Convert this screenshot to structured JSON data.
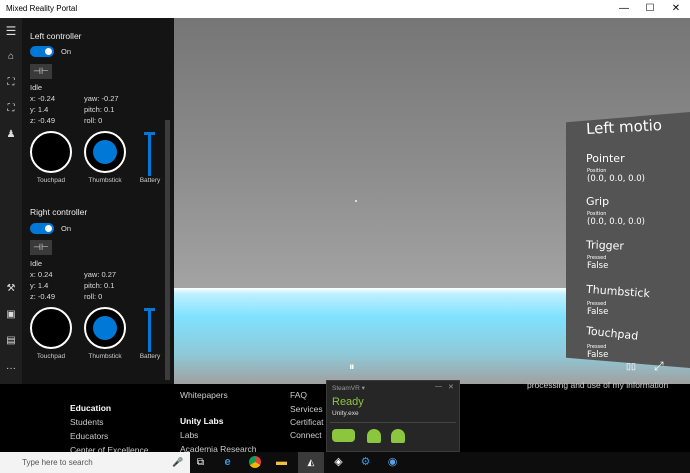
{
  "window": {
    "title": "Mixed Reality Portal",
    "minimize": "—",
    "maximize": "☐",
    "close": "✕"
  },
  "sidebar": {
    "items": [
      {
        "icon": "menu-icon",
        "glyph": "☰"
      },
      {
        "icon": "headset-icon",
        "glyph": "⌂"
      },
      {
        "icon": "controller-icon",
        "glyph": "⛶"
      },
      {
        "icon": "controller-alt-icon",
        "glyph": "⛶"
      },
      {
        "icon": "people-icon",
        "glyph": "♟"
      },
      {
        "icon": "tools-icon",
        "glyph": "⚒"
      },
      {
        "icon": "photo-icon",
        "glyph": "▣"
      },
      {
        "icon": "store-icon",
        "glyph": "▤"
      },
      {
        "icon": "more-icon",
        "glyph": "···"
      }
    ]
  },
  "left_controller": {
    "title": "Left controller",
    "toggle_label": "On",
    "pin_glyph": "⊣⊢",
    "status": "Idle",
    "x": "x: -0.24",
    "y": "y: 1.4",
    "z": "z: -0.49",
    "yaw": "yaw: -0.27",
    "pitch": "pitch: 0.1",
    "roll": "roll: 0",
    "touchpad_label": "Touchpad",
    "thumbstick_label": "Thumbstick",
    "battery_label": "Battery"
  },
  "right_controller": {
    "title": "Right controller",
    "toggle_label": "On",
    "pin_glyph": "⊣⊢",
    "status": "Idle",
    "x": "x: 0.24",
    "y": "y: 1.4",
    "z": "z: -0.49",
    "yaw": "yaw: 0.27",
    "pitch": "pitch: 0.1",
    "roll": "roll: 0",
    "touchpad_label": "Touchpad",
    "thumbstick_label": "Thumbstick",
    "battery_label": "Battery"
  },
  "viewport": {
    "pause_glyph": "⏸",
    "window_glyph": "▯▯",
    "expand_glyph": "⤢",
    "sign": {
      "title": "Left motio",
      "items": [
        {
          "name": "Pointer",
          "sub": "Position",
          "value": "(0.0, 0.0, 0.0)"
        },
        {
          "name": "Grip",
          "sub": "Position",
          "value": "(0.0, 0.0, 0.0)"
        },
        {
          "name": "Trigger",
          "sub": "Pressed",
          "value": "False"
        },
        {
          "name": "Thumbstick",
          "sub": "Pressed",
          "value": "False"
        },
        {
          "name": "Touchpad",
          "sub": "Pressed",
          "value": "False"
        }
      ]
    }
  },
  "web": {
    "education_heading": "Education",
    "students": "Students",
    "educators": "Educators",
    "center": "Center of Excellence",
    "whitepapers": "Whitepapers",
    "unity_labs": "Unity Labs",
    "labs": "Labs",
    "academia": "Academia Research",
    "faq": "FAQ",
    "services": "Services",
    "certification": "Certificat",
    "connect": "Connect",
    "privacy": "processing and use of my information"
  },
  "steamvr": {
    "title": "SteamVR ▾",
    "status": "Ready",
    "process": "Unity.exe",
    "min": "—",
    "close": "✕"
  },
  "taskbar": {
    "search_placeholder": "Type here to search",
    "mic_glyph": "🎤"
  }
}
